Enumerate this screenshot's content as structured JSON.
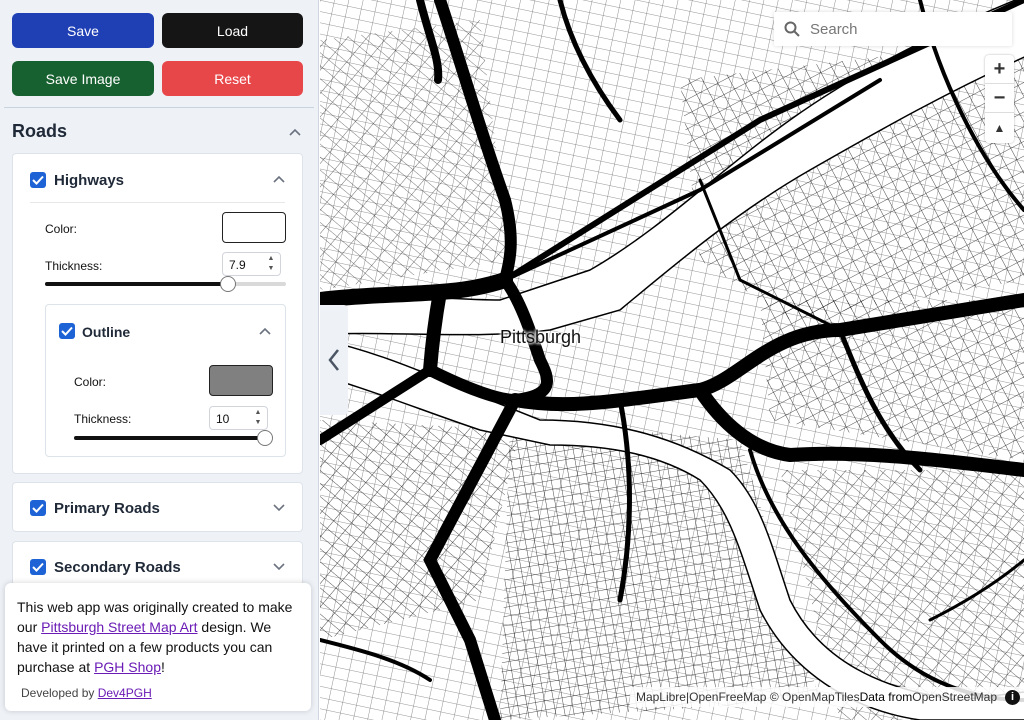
{
  "buttons": {
    "save": "Save",
    "load": "Load",
    "save_image": "Save Image",
    "reset": "Reset"
  },
  "colors": {
    "save": "#1f3fb5",
    "load": "#151515",
    "save_image": "#17602f",
    "reset": "#e8474a",
    "checkbox": "#1e63d6"
  },
  "roads": {
    "title": "Roads",
    "highways": {
      "title": "Highways",
      "checked": true,
      "color_label": "Color:",
      "color_value": "#ffffff",
      "thickness_label": "Thickness:",
      "thickness_value": "7.9",
      "slider_fraction": 0.76,
      "outline": {
        "title": "Outline",
        "checked": true,
        "color_label": "Color:",
        "color_value": "#808080",
        "thickness_label": "Thickness:",
        "thickness_value": "10",
        "slider_fraction": 1.0
      }
    },
    "primary": {
      "title": "Primary Roads",
      "checked": true
    },
    "secondary": {
      "title": "Secondary Roads",
      "checked": true
    }
  },
  "info": {
    "text1": "This web app was originally created to make our ",
    "link1": "Pittsburgh Street Map Art",
    "text2": " design. We have it printed on a few products you can purchase at ",
    "link2": "PGH Shop",
    "text3": "!",
    "dev_prefix": "Developed by ",
    "dev_link": "Dev4PGH"
  },
  "map": {
    "city_label": "Pittsburgh",
    "search_placeholder": "Search",
    "zoom_in": "+",
    "zoom_out": "−",
    "compass": "▲",
    "attribution": {
      "maplibre": "MapLibre",
      "sep": " | ",
      "tiles": "OpenFreeMap © OpenMapTiles ",
      "data_prefix": "Data from ",
      "osm": "OpenStreetMap",
      "info_icon": "i"
    }
  }
}
